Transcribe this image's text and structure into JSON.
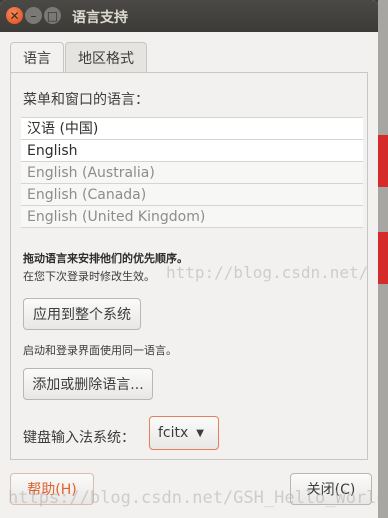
{
  "window": {
    "title": "语言支持",
    "controls": {
      "close": "✕",
      "minimize": "–",
      "maximize": "□"
    }
  },
  "tabs": [
    {
      "label": "语言",
      "active": true
    },
    {
      "label": "地区格式",
      "active": false
    }
  ],
  "language_panel": {
    "menu_label": "菜单和窗口的语言：",
    "languages": [
      {
        "label": "汉语 (中国)",
        "state": "primary"
      },
      {
        "label": "English",
        "state": "primary"
      },
      {
        "label": "English (Australia)",
        "state": "dimmed"
      },
      {
        "label": "English (Canada)",
        "state": "dimmed"
      },
      {
        "label": "English (United Kingdom)",
        "state": "dimmed"
      }
    ],
    "drag_hint": "拖动语言来安排他们的优先顺序。",
    "next_login_note": "在您下次登录时修改生效。",
    "apply_button": "应用到整个系统",
    "login_screen_note": "启动和登录界面使用同一语言。",
    "add_remove_button": "添加或删除语言...",
    "ime_label": "键盘输入法系统：",
    "ime_value": "fcitx",
    "ime_arrow": "▼"
  },
  "footer": {
    "help_button": "帮助(H)",
    "close_button": "关闭(C)"
  },
  "watermark": {
    "panel_text": "http://blog.csdn.net/",
    "bottom_text": "https://blog.csdn.net/GSH_Hello_World"
  },
  "colors": {
    "accent": "#e1602c",
    "titlebar": "#3c3b37",
    "window_bg": "#f2f1f0",
    "close_button": "#df4a16"
  }
}
